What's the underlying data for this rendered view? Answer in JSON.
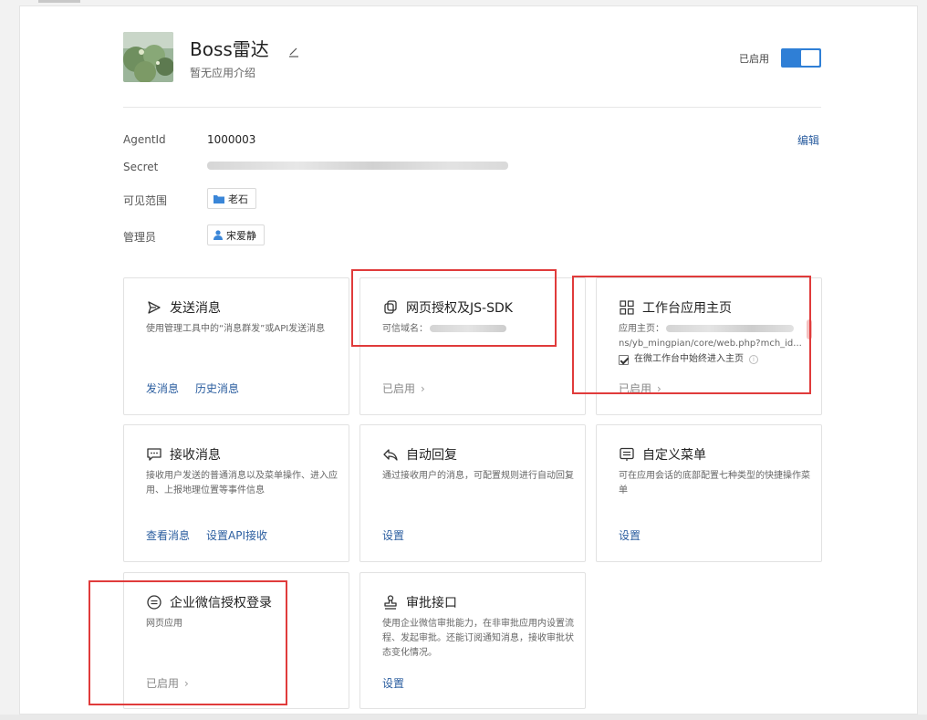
{
  "app": {
    "name": "Boss雷达",
    "description": "暂无应用介绍",
    "enabled_label": "已启用",
    "enabled": true
  },
  "info": {
    "agentid_label": "AgentId",
    "agentid_value": "1000003",
    "secret_label": "Secret",
    "scope_label": "可见范围",
    "scope_value": "老石",
    "admin_label": "管理员",
    "admin_value": "宋爱静",
    "edit_label": "编辑"
  },
  "cards": {
    "send_message": {
      "title": "发送消息",
      "desc": "使用管理工具中的“消息群发”或API发送消息",
      "links": [
        "发消息",
        "历史消息"
      ]
    },
    "web_auth": {
      "title": "网页授权及JS-SDK",
      "desc_prefix": "可信域名：",
      "status": "已启用"
    },
    "workbench": {
      "title": "工作台应用主页",
      "desc_prefix": "应用主页：",
      "url_line": "ns/yb_mingpian/core/web.php?mch_id...",
      "checkbox_label": "在微工作台中始终进入主页",
      "status": "已启用"
    },
    "receive_message": {
      "title": "接收消息",
      "desc": "接收用户发送的普通消息以及菜单操作、进入应用、上报地理位置等事件信息",
      "links": [
        "查看消息",
        "设置API接收"
      ]
    },
    "auto_reply": {
      "title": "自动回复",
      "desc": "通过接收用户的消息，可配置规则进行自动回复",
      "link": "设置"
    },
    "custom_menu": {
      "title": "自定义菜单",
      "desc": "可在应用会话的底部配置七种类型的快捷操作菜单",
      "link": "设置"
    },
    "wework_login": {
      "title": "企业微信授权登录",
      "desc": "网页应用",
      "status": "已启用"
    },
    "approval": {
      "title": "审批接口",
      "desc": "使用企业微信审批能力，在非审批应用内设置流程、发起审批。还能订阅通知消息，接收审批状态变化情况。",
      "link": "设置"
    }
  },
  "colors": {
    "accent": "#2f7fd6",
    "link": "#2a5d9f",
    "highlight": "#e03b3b"
  }
}
